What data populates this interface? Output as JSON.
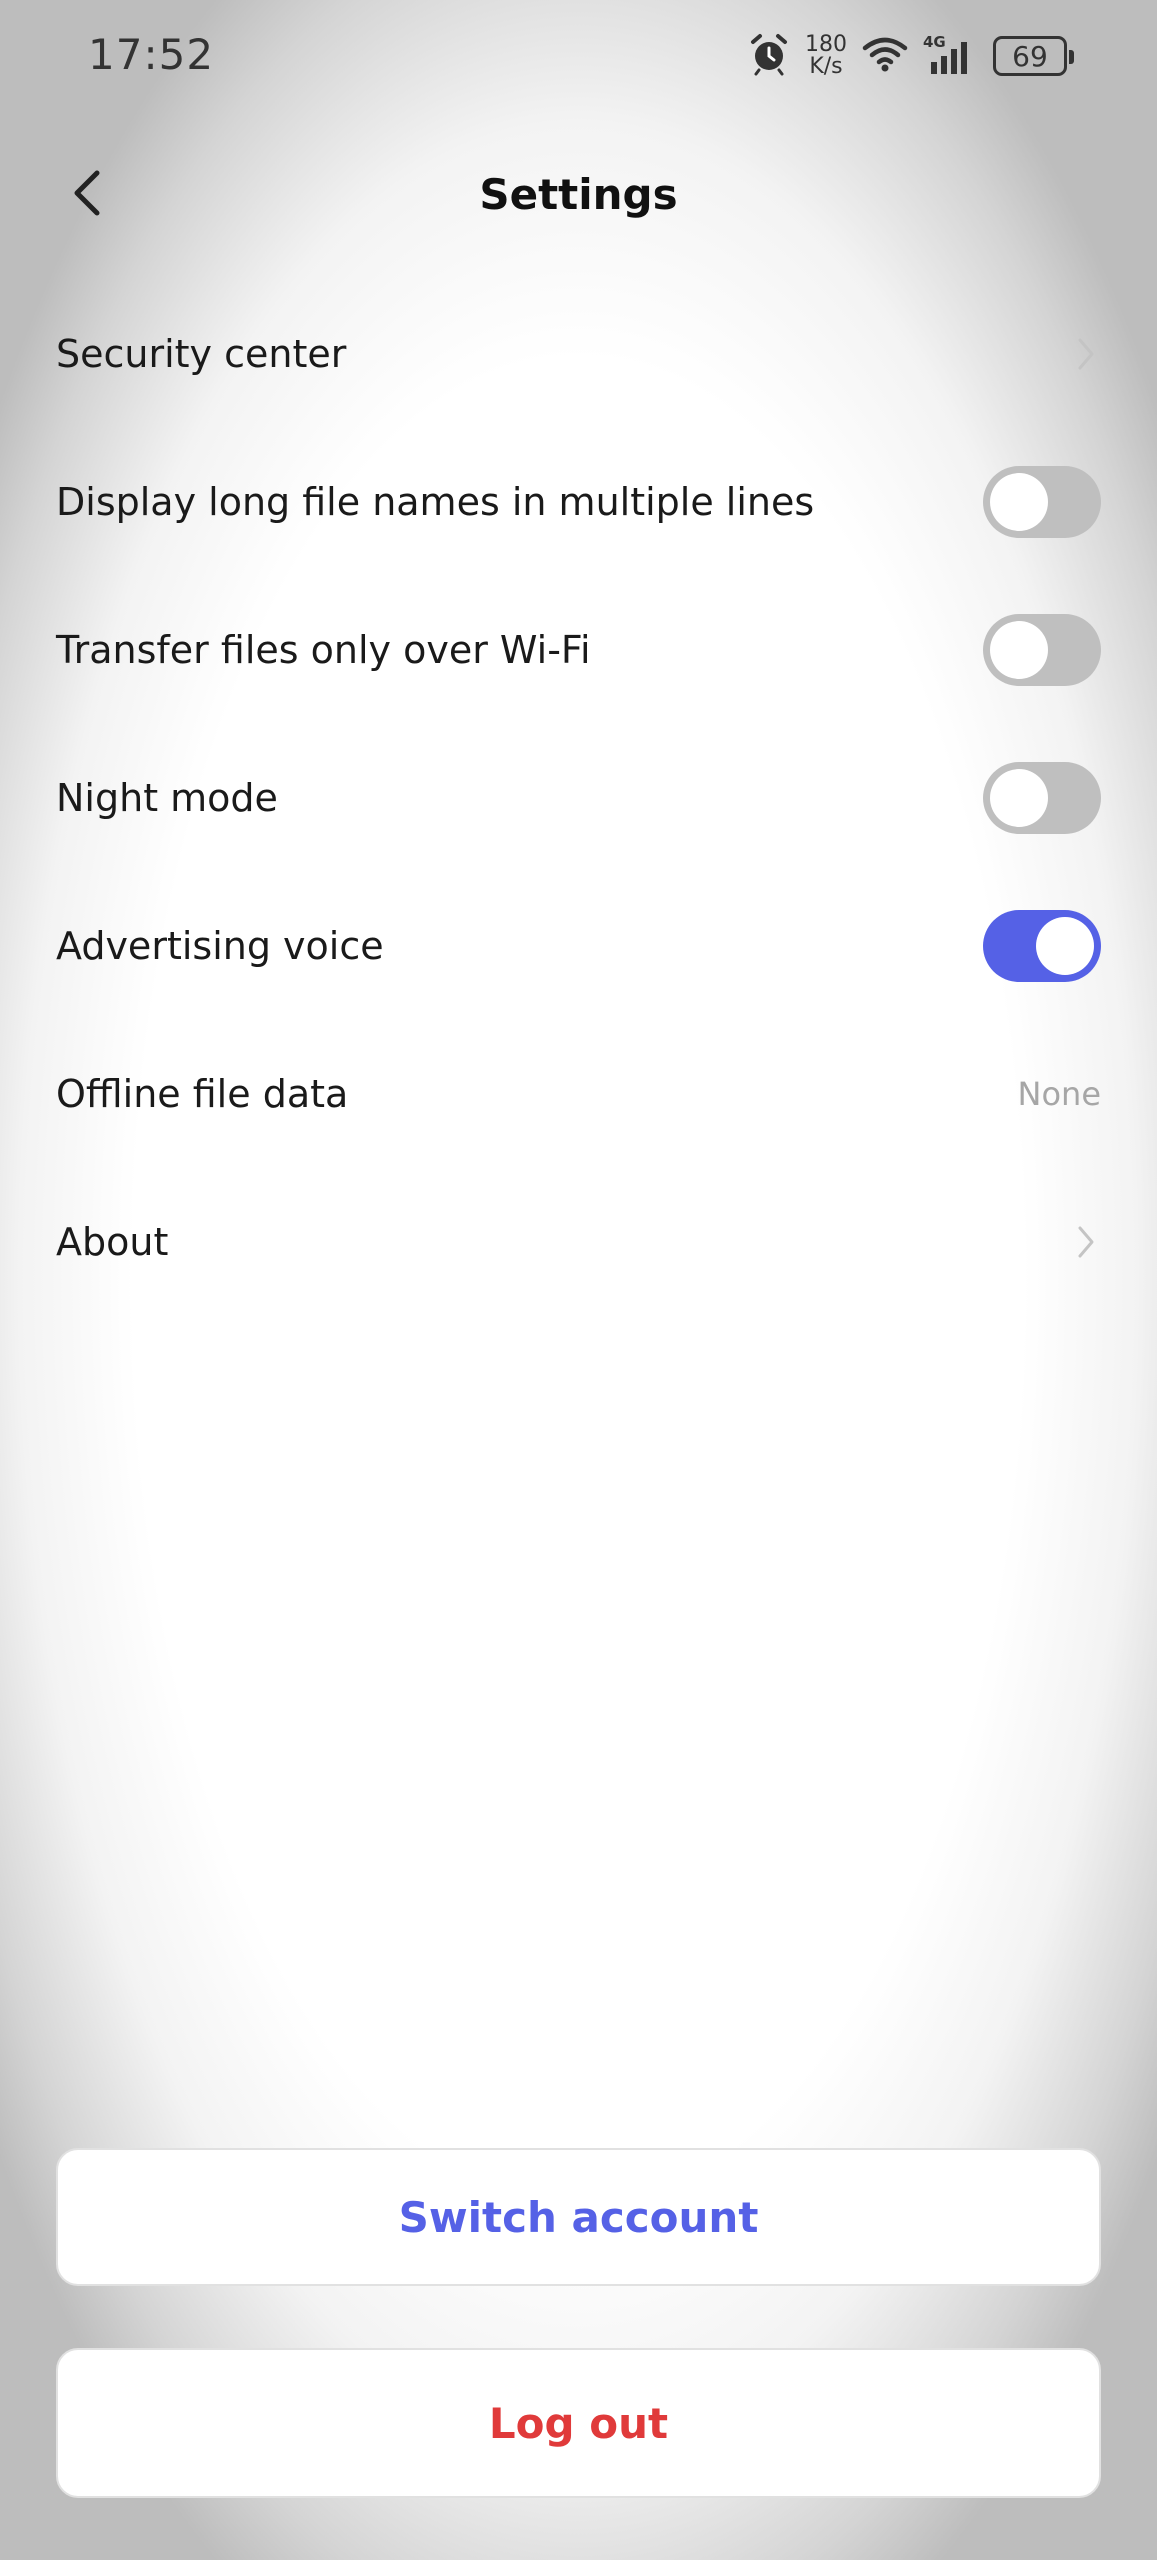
{
  "status_bar": {
    "time": "17:52",
    "net_speed_value": "180",
    "net_speed_unit": "K/s",
    "network": "4G",
    "battery": "69"
  },
  "header": {
    "title": "Settings"
  },
  "settings": {
    "items": [
      {
        "label": "Security center",
        "control": "chevron"
      },
      {
        "label": "Display long file names in multiple lines",
        "control": "toggle",
        "state": "off"
      },
      {
        "label": "Transfer files only over Wi-Fi",
        "control": "toggle",
        "state": "off"
      },
      {
        "label": "Night mode",
        "control": "toggle",
        "state": "off"
      },
      {
        "label": "Advertising voice",
        "control": "toggle",
        "state": "on"
      },
      {
        "label": "Offline file data",
        "control": "value",
        "value": "None"
      },
      {
        "label": "About",
        "control": "chevron"
      }
    ]
  },
  "buttons": {
    "switch_account": "Switch account",
    "log_out": "Log out"
  },
  "colors": {
    "accent": "#5561e6",
    "danger": "#e03a3a",
    "toggle_off": "#bfbfbf"
  }
}
